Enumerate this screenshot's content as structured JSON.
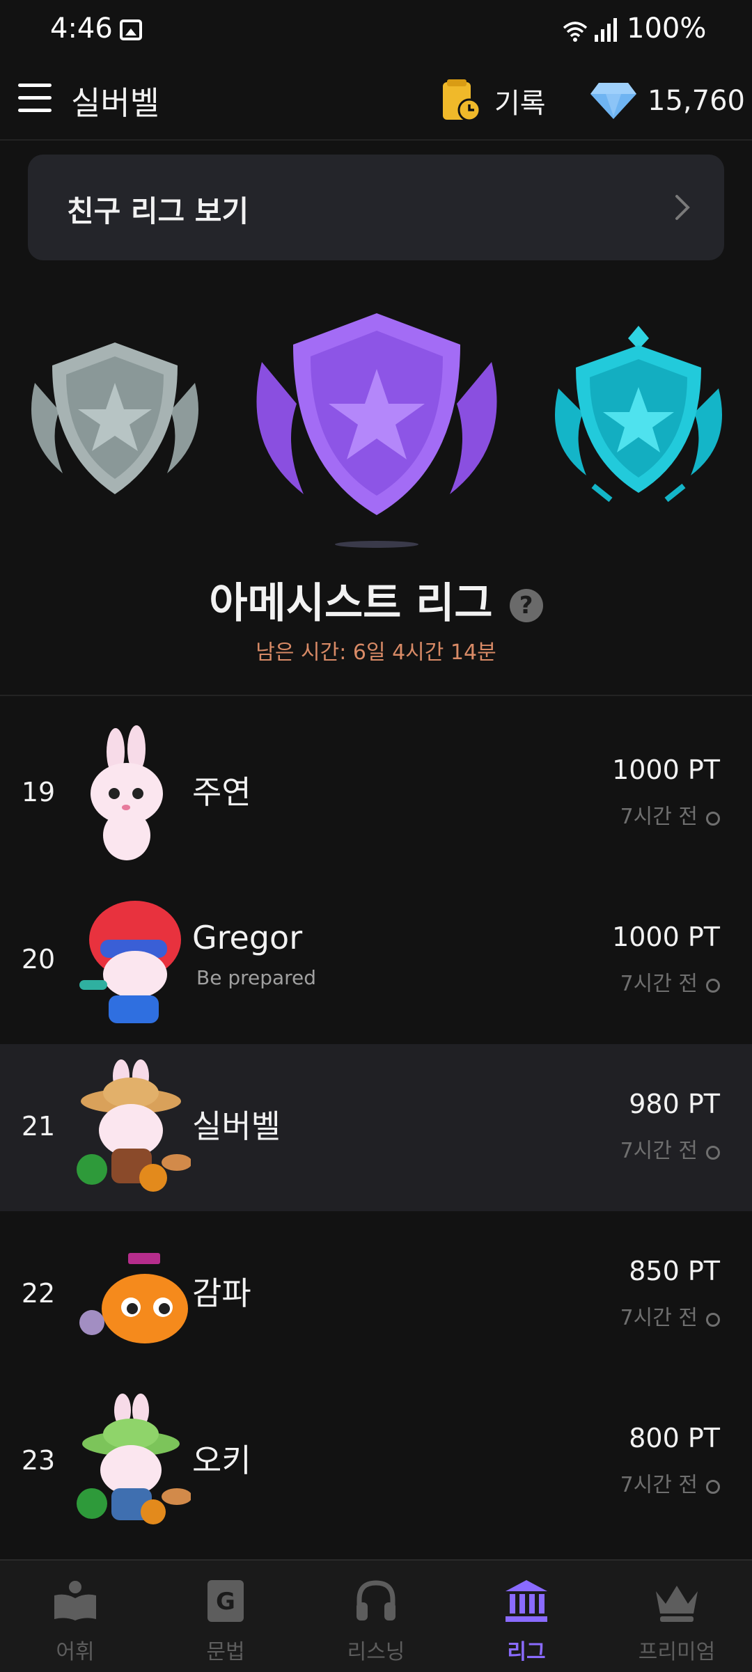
{
  "status_bar": {
    "time": "4:46",
    "battery": "100%"
  },
  "app_bar": {
    "title": "실버벨",
    "record_label": "기록",
    "gem_count": "15,760"
  },
  "friend_league": {
    "label": "친구 리그 보기"
  },
  "league": {
    "title": "아메시스트 리그",
    "help": "?",
    "time_left": "남은 시간: 6일 4시간 14분",
    "colors": {
      "amethyst": "#9b5cf0",
      "silver": "#9aa6a6",
      "aqua": "#22c7d8"
    }
  },
  "rankings": [
    {
      "rank": "19",
      "name": "주연",
      "status": "",
      "points": "1000 PT",
      "time": "7시간 전"
    },
    {
      "rank": "20",
      "name": "Gregor",
      "status": "Be prepared",
      "points": "1000 PT",
      "time": "7시간 전"
    },
    {
      "rank": "21",
      "name": "실버벨",
      "status": "",
      "points": "980 PT",
      "time": "7시간 전"
    },
    {
      "rank": "22",
      "name": "감파",
      "status": "",
      "points": "850 PT",
      "time": "7시간 전"
    },
    {
      "rank": "23",
      "name": "오키",
      "status": "",
      "points": "800 PT",
      "time": "7시간 전"
    }
  ],
  "bottom_nav": [
    {
      "label": "어휘",
      "icon": "book-icon"
    },
    {
      "label": "문법",
      "icon": "grammar-book-icon"
    },
    {
      "label": "리스닝",
      "icon": "headphones-icon"
    },
    {
      "label": "리그",
      "icon": "league-building-icon",
      "active": true
    },
    {
      "label": "프리미엄",
      "icon": "crown-icon"
    }
  ],
  "accent_color": "#8a6bff"
}
